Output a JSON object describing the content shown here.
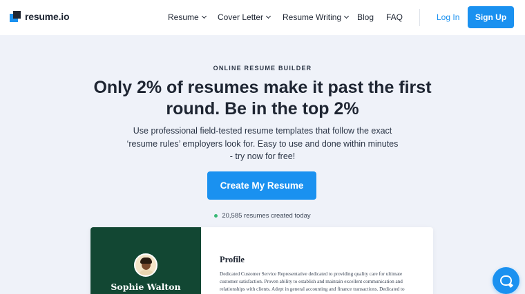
{
  "header": {
    "logo_text": "resume.io",
    "nav": [
      {
        "label": "Resume",
        "has_dropdown": true
      },
      {
        "label": "Cover Letter",
        "has_dropdown": true
      },
      {
        "label": "Resume Writing",
        "has_dropdown": true
      },
      {
        "label": "Blog",
        "has_dropdown": false
      },
      {
        "label": "FAQ",
        "has_dropdown": false
      }
    ],
    "login_label": "Log In",
    "signup_label": "Sign Up"
  },
  "hero": {
    "eyebrow": "ONLINE RESUME BUILDER",
    "headline": "Only 2% of resumes make it past the first round. Be in the top 2%",
    "subtext": "Use professional field-tested resume templates that follow the exact ‘resume rules’ employers look for. Easy to use and done within minutes - try now for free!",
    "cta_label": "Create My Resume",
    "counter_text": "20,585 resumes created today"
  },
  "resume_preview": {
    "name": "Sophie Walton",
    "section_title": "Profile",
    "profile_text": "Dedicated Customer Service Representative dedicated to providing quality care for ultimate customer satisfaction. Proven ability to establish and maintain excellent communication and relationships with clients. Adept in general accounting and finance transactions. Dedicated to identifying customer needs and delivering"
  },
  "colors": {
    "accent": "#1a91f0",
    "resume_sidebar": "#124733",
    "page_background": "#eff2f9",
    "status_dot": "#37b875"
  },
  "icons": {
    "logo": "resume-io-logo-mark",
    "chat": "chat-bubble-icon",
    "dropdown": "chevron-down-icon"
  }
}
